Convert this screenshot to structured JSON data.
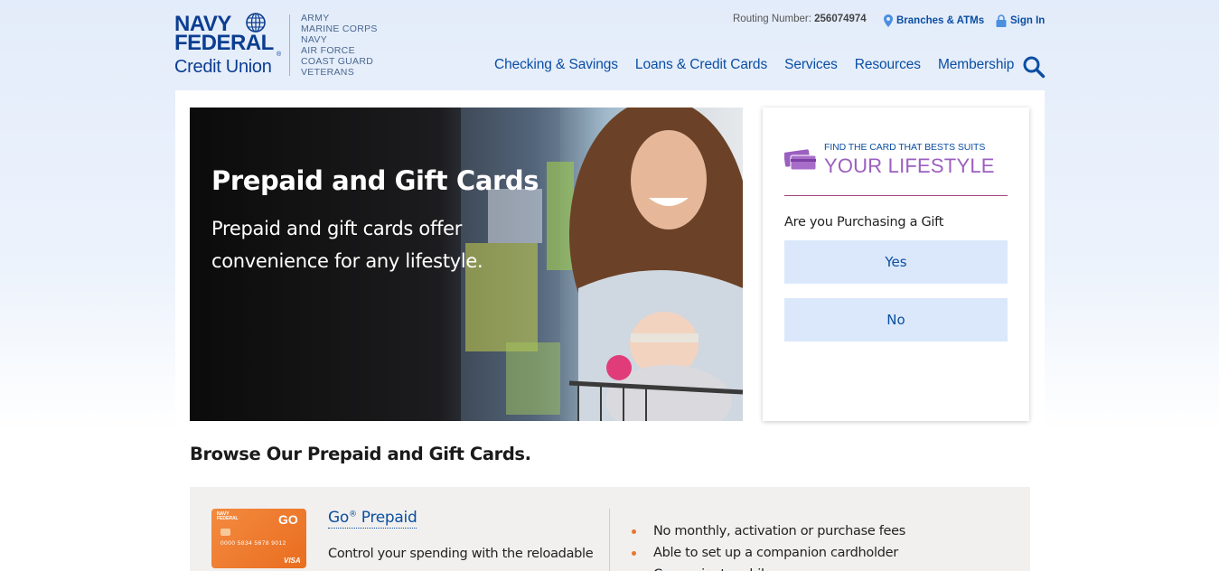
{
  "header": {
    "logo": {
      "line1": "NAVY",
      "line2": "FEDERAL",
      "line3": "Credit Union",
      "reg": "®",
      "branches": [
        "ARMY",
        "MARINE CORPS",
        "NAVY",
        "AIR FORCE",
        "COAST GUARD",
        "VETERANS"
      ]
    },
    "routing_label": "Routing Number:",
    "routing_number": "256074974",
    "branches_atms": "Branches & ATMs",
    "sign_in": "Sign In",
    "nav": [
      "Checking & Savings",
      "Loans & Credit Cards",
      "Services",
      "Resources",
      "Membership"
    ]
  },
  "hero": {
    "title": "Prepaid and Gift Cards",
    "subtitle": "Prepaid and gift cards offer convenience for any lifestyle."
  },
  "finder": {
    "small": "FIND THE CARD THAT BESTS SUITS",
    "big": "YOUR LIFESTYLE",
    "question": "Are you Purchasing a Gift",
    "yes": "Yes",
    "no": "No"
  },
  "browse_title": "Browse Our Prepaid and Gift Cards.",
  "product": {
    "name": "Go",
    "name_sup": "®",
    "name_rest": " Prepaid",
    "description": "Control your spending with the reloadable",
    "card_brand_line1": "NAVY",
    "card_brand_line2": "FEDERAL",
    "card_go": "GO",
    "card_number": "0000 5834 5678 9012",
    "card_network": "VISA",
    "features": [
      "No monthly, activation or purchase fees",
      "Able to set up a companion cardholder",
      "Convenient mobile app"
    ]
  },
  "colors": {
    "brand_navy": "#0b3d91",
    "link_blue": "#0b4ea2",
    "lifestyle_purple": "#9b5fc0",
    "option_bg": "#dbe8fb",
    "bullet_orange": "#e8772e"
  }
}
